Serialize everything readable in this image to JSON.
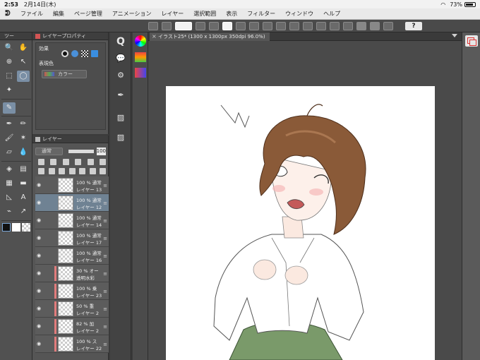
{
  "status": {
    "time": "2:53",
    "date": "2月14日(木)",
    "battery": "73%"
  },
  "menu": [
    "ファイル",
    "編集",
    "ページ管理",
    "アニメーション",
    "レイヤー",
    "選択範囲",
    "表示",
    "フィルター",
    "ウィンドウ",
    "ヘルプ"
  ],
  "tools_panel": {
    "title": "ツー"
  },
  "property_panel": {
    "title": "レイヤープロパティ",
    "effect_label": "効果",
    "display_color_label": "表現色",
    "display_color_value": "カラー"
  },
  "layer_panel": {
    "title": "レイヤー",
    "blend_mode": "通常",
    "opacity": "100",
    "layers": [
      {
        "mode": "100 % 通常",
        "name": "レイヤー 13",
        "selected": false,
        "stripe": false
      },
      {
        "mode": "100 % 通常",
        "name": "レイヤー 12",
        "selected": true,
        "stripe": false
      },
      {
        "mode": "100 % 通常",
        "name": "レイヤー 14",
        "selected": false,
        "stripe": false
      },
      {
        "mode": "100 % 通常",
        "name": "レイヤー 17",
        "selected": false,
        "stripe": false
      },
      {
        "mode": "100 % 通常",
        "name": "レイヤー 16",
        "selected": false,
        "stripe": false
      },
      {
        "mode": "30 % オー",
        "name": "透明水彩",
        "selected": false,
        "stripe": true
      },
      {
        "mode": "100 % 乗",
        "name": "レイヤー 23",
        "selected": false,
        "stripe": true
      },
      {
        "mode": "50 % 重",
        "name": "レイヤー 2",
        "selected": false,
        "stripe": true
      },
      {
        "mode": "82 % 加",
        "name": "レイヤー 2",
        "selected": false,
        "stripe": true
      },
      {
        "mode": "100 % ス",
        "name": "レイヤー 22",
        "selected": false,
        "stripe": true
      }
    ]
  },
  "canvas": {
    "tab_title": "イラスト25* (1300 x 1300px 350dpi 96.0%)"
  },
  "toolbar": {
    "help_label": "?"
  },
  "colors": {
    "accent": "#6f8293",
    "hair": "#8a5a38",
    "skirt": "#7a9a6a",
    "layer_stripe": "#e17c7c"
  },
  "icons": [
    "menu-logo-icon",
    "brush-icon",
    "lasso-icon",
    "eyedropper-icon",
    "text-icon",
    "eye-icon",
    "color-wheel-icon",
    "layer-icon"
  ]
}
